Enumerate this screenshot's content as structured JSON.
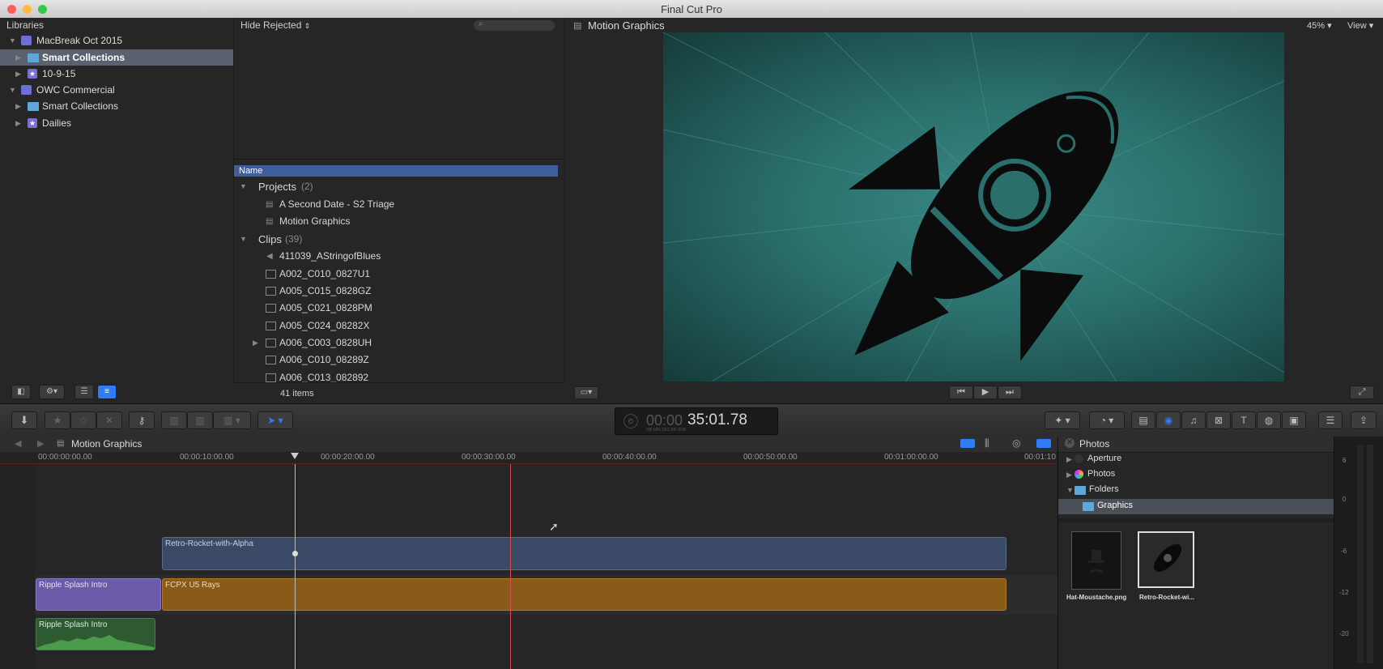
{
  "window": {
    "title": "Final Cut Pro"
  },
  "libraries": {
    "header": "Libraries",
    "items": [
      {
        "label": "MacBreak Oct 2015"
      },
      {
        "label": "Smart Collections"
      },
      {
        "label": "10-9-15"
      },
      {
        "label": "OWC Commercial"
      },
      {
        "label": "Smart Collections"
      },
      {
        "label": "Dailies"
      }
    ]
  },
  "browser": {
    "filter": "Hide Rejected",
    "column_name": "Name",
    "projects_label": "Projects",
    "projects_count": "(2)",
    "projects": [
      "A Second Date - S2 Triage",
      "Motion Graphics"
    ],
    "clips_label": "Clips",
    "clips_count": "(39)",
    "clips": [
      "411039_AStringofBlues",
      "A002_C010_0827U1",
      "A005_C015_0828GZ",
      "A005_C021_0828PM",
      "A005_C024_08282X",
      "A006_C003_0828UH",
      "A006_C010_08289Z",
      "A006_C013_082892"
    ],
    "item_count": "41 items"
  },
  "viewer": {
    "title": "Motion Graphics",
    "zoom": "45%",
    "view_label": "View"
  },
  "timecode": {
    "value": "35:01.78",
    "dim_prefix": "00:00",
    "units": "HR  MIN  SEC  FR  SUB"
  },
  "timeline": {
    "title": "Motion Graphics",
    "ruler": [
      "00:00:00:00.00",
      "00:00:10:00.00",
      "00:00:20:00.00",
      "00:00:30:00.00",
      "00:00:40:00.00",
      "00:00:50:00.00",
      "00:01:00:00.00",
      "00:01:10"
    ],
    "clips": {
      "rocket": "Retro-Rocket-with-Alpha",
      "ripple_video": "Ripple Splash Intro",
      "rays": "FCPX U5 Rays",
      "ripple_audio": "Ripple Splash Intro"
    }
  },
  "photos": {
    "header": "Photos",
    "items": [
      "Aperture",
      "Photos",
      "Folders",
      "Graphics"
    ],
    "thumbs": [
      "Hat-Moustache.png",
      "Retro-Rocket-wi..."
    ]
  },
  "meters": {
    "labels": [
      "6",
      "0",
      "-6",
      "-12",
      "-20"
    ]
  },
  "colors": {
    "accent": "#2e7cf6",
    "selection": "#5a6270",
    "teal": "#2a6f6c",
    "rays_clip": "#8a5a18",
    "rocket_clip": "#3a4a66",
    "ripple_clip": "#6a5aa8",
    "audio_clip": "#2e5a32"
  }
}
